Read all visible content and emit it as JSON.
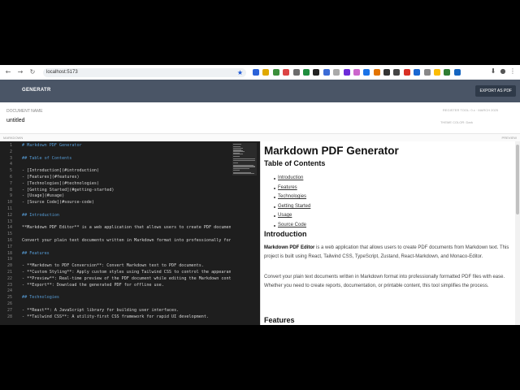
{
  "browser": {
    "url": "localhost:5173",
    "extensions": [
      "#2b62d9",
      "#e0a900",
      "#3b8f3b",
      "#d44",
      "#6c6c6c",
      "#1e8e3e",
      "#222",
      "#3b6bd6",
      "#aaa",
      "#6c2bd9",
      "#c6c",
      "#1a73e8",
      "#e37400",
      "#333",
      "#444",
      "#d93025",
      "#1967d2",
      "#888",
      "#fbbc04",
      "#2e7d32",
      "#1565c0"
    ]
  },
  "app": {
    "logo": "GENERATR",
    "export_label": "EXPORT AS PDF"
  },
  "doc": {
    "label": "DOCUMENT NAME",
    "name": "untitled",
    "meta1": "REGISTER TOOL: 0.x  ·  MARCH 2025",
    "meta2": "THEME COLOR: Dark"
  },
  "panes": {
    "left": "MARKDOWN",
    "right": "PREVIEW"
  },
  "editor": {
    "lines": [
      {
        "n": "1",
        "t": "# Markdown PDF Generator",
        "h": true
      },
      {
        "n": "2",
        "t": ""
      },
      {
        "n": "3",
        "t": "## Table of Contents",
        "h": true
      },
      {
        "n": "4",
        "t": ""
      },
      {
        "n": "5",
        "t": "- [Introduction](#introduction)"
      },
      {
        "n": "6",
        "t": "- [Features](#features)"
      },
      {
        "n": "7",
        "t": "- [Technologies](#technologies)"
      },
      {
        "n": "8",
        "t": "- [Getting Started](#getting-started)"
      },
      {
        "n": "9",
        "t": "- [Usage](#usage)"
      },
      {
        "n": "10",
        "t": "- [Source Code](#source-code)"
      },
      {
        "n": "11",
        "t": ""
      },
      {
        "n": "12",
        "t": "## Introduction",
        "h": true
      },
      {
        "n": "13",
        "t": ""
      },
      {
        "n": "14",
        "t": "**Markdown PDF Editor** is a web application that allows users to create PDF documents"
      },
      {
        "n": "15",
        "t": ""
      },
      {
        "n": "16",
        "t": "Convert your plain text documents written in Markdown format into professionally formatted"
      },
      {
        "n": "17",
        "t": ""
      },
      {
        "n": "18",
        "t": "## Features",
        "h": true
      },
      {
        "n": "19",
        "t": ""
      },
      {
        "n": "20",
        "t": "- **Markdown to PDF Conversion**: Convert Markdown text to PDF documents."
      },
      {
        "n": "21",
        "t": "- **Custom Styling**: Apply custom styles using Tailwind CSS to control the appearance"
      },
      {
        "n": "22",
        "t": "- **Preview**: Real-time preview of the PDF document while editing the Markdown content"
      },
      {
        "n": "23",
        "t": "- **Export**: Download the generated PDF for offline use."
      },
      {
        "n": "24",
        "t": ""
      },
      {
        "n": "25",
        "t": "## Technologies",
        "h": true
      },
      {
        "n": "26",
        "t": ""
      },
      {
        "n": "27",
        "t": "- **React**: A JavaScript library for building user interfaces."
      },
      {
        "n": "28",
        "t": "- **Tailwind CSS**: A utility-first CSS framework for rapid UI development."
      }
    ]
  },
  "preview": {
    "title": "Markdown PDF Generator",
    "toc_heading": "Table of Contents",
    "toc": [
      "Introduction",
      "Features",
      "Technologies",
      "Getting Started",
      "Usage",
      "Source Code"
    ],
    "intro_heading": "Introduction",
    "p1_bold": "Markdown PDF Editor",
    "p1_rest": " is a web application that allows users to create PDF documents from Markdown text. This project is built using React, Tailwind CSS, TypeScript, Zustand, React-Markdown, and Monaco-Editor.",
    "p2": "Convert your plain text documents written in Markdown format into professionally formatted PDF files with ease. Whether you need to create reports, documentation, or printable content, this tool simplifies the process.",
    "features_heading": "Features"
  }
}
